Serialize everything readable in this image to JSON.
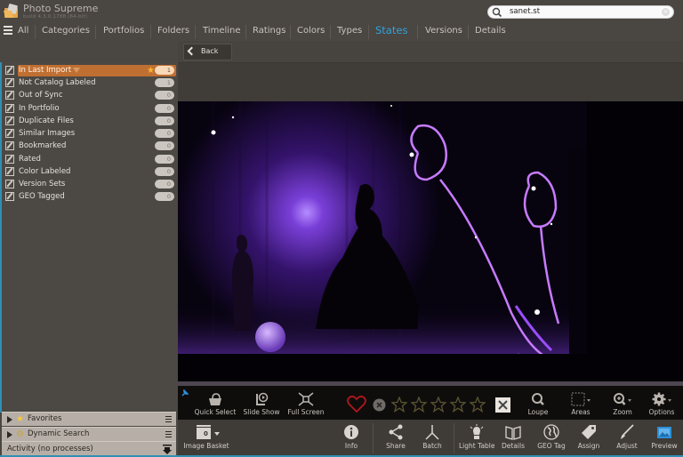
{
  "app": {
    "title": "Photo Supreme",
    "build": "build 4.3.0.1788 (64-bit)"
  },
  "search": {
    "value": "sanet.st",
    "placeholder": ""
  },
  "nav": {
    "tabs": [
      {
        "label": "All",
        "active": false
      },
      {
        "label": "Categories",
        "active": false
      },
      {
        "label": "Portfolios",
        "active": false
      },
      {
        "label": "Folders",
        "active": false
      },
      {
        "label": "Timeline",
        "active": false
      },
      {
        "label": "Ratings",
        "active": false
      },
      {
        "label": "Colors",
        "active": false
      },
      {
        "label": "Types",
        "active": false
      },
      {
        "label": "States",
        "active": true
      },
      {
        "label": "Versions",
        "active": false
      },
      {
        "label": "Details",
        "active": false
      }
    ],
    "active_color": "#2ea3e0"
  },
  "back_button": {
    "label": "Back"
  },
  "states": [
    {
      "label": "In Last Import",
      "count": "1",
      "selected": true,
      "favorite": true
    },
    {
      "label": "Not Catalog Labeled",
      "count": "1",
      "selected": false
    },
    {
      "label": "Out of Sync",
      "count": "0",
      "selected": false
    },
    {
      "label": "In Portfolio",
      "count": "0",
      "selected": false
    },
    {
      "label": "Duplicate Files",
      "count": "0",
      "selected": false
    },
    {
      "label": "Similar Images",
      "count": "0",
      "selected": false
    },
    {
      "label": "Bookmarked",
      "count": "0",
      "selected": false
    },
    {
      "label": "Rated",
      "count": "0",
      "selected": false
    },
    {
      "label": "Color Labeled",
      "count": "0",
      "selected": false
    },
    {
      "label": "Version Sets",
      "count": "0",
      "selected": false
    },
    {
      "label": "GEO Tagged",
      "count": "0",
      "selected": false
    }
  ],
  "panels": {
    "favorites": "Favorites",
    "dynamic_search": "Dynamic Search",
    "activity": "Activity (no processes)"
  },
  "toolbar_top": {
    "quick_select": "Quick Select",
    "slide_show": "Slide Show",
    "full_screen": "Full Screen",
    "loupe": "Loupe",
    "areas": "Areas",
    "zoom": "Zoom",
    "options": "Options",
    "rating": 0,
    "rating_max": 5
  },
  "toolbar_bottom": {
    "image_basket": "Image Basket",
    "basket_count": "0",
    "info": "Info",
    "share": "Share",
    "batch": "Batch",
    "light_table": "Light Table",
    "details": "Details",
    "geo_tag": "GEO Tag",
    "assign": "Assign",
    "adjust": "Adjust",
    "preview": "Preview"
  },
  "colors": {
    "accent": "#2ea3e0",
    "selection": "#c06f32",
    "favorite_star": "#f6b530",
    "heart": "#b3171c"
  }
}
